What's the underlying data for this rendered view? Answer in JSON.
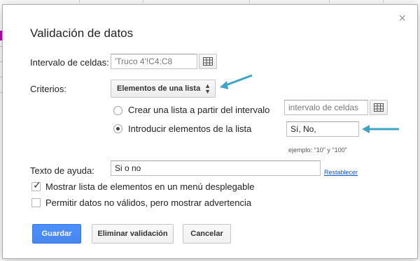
{
  "dialog": {
    "title": "Validación de datos",
    "close_glyph": "×"
  },
  "range": {
    "label": "Intervalo de celdas:",
    "value": "'Truco 4'!C4:C8",
    "icon": "grid-icon"
  },
  "criteria": {
    "label": "Criterios:",
    "selected": "Elementos de una lista",
    "options": [
      {
        "label": "Crear una lista a partir del intervalo",
        "placeholder": "intervalo de celdas",
        "selected": false
      },
      {
        "label": "Introducir elementos de la lista",
        "value": "Sí, No,",
        "selected": true
      }
    ],
    "example": "ejemplo: \"10\" y \"100\""
  },
  "help": {
    "label": "Texto de ayuda:",
    "value": "Si o no",
    "reset_link": "Restablecer"
  },
  "checkboxes": [
    {
      "label": "Mostrar lista de elementos en un menú desplegable",
      "checked": true
    },
    {
      "label": "Permitir datos no válidos, pero mostrar advertencia",
      "checked": false
    }
  ],
  "buttons": {
    "save": "Guardar",
    "remove": "Eliminar validación",
    "cancel": "Cancelar"
  },
  "colors": {
    "primary_button": "#4d90fe",
    "annotation_arrow": "#3ea3c9",
    "link": "#1155cc"
  }
}
